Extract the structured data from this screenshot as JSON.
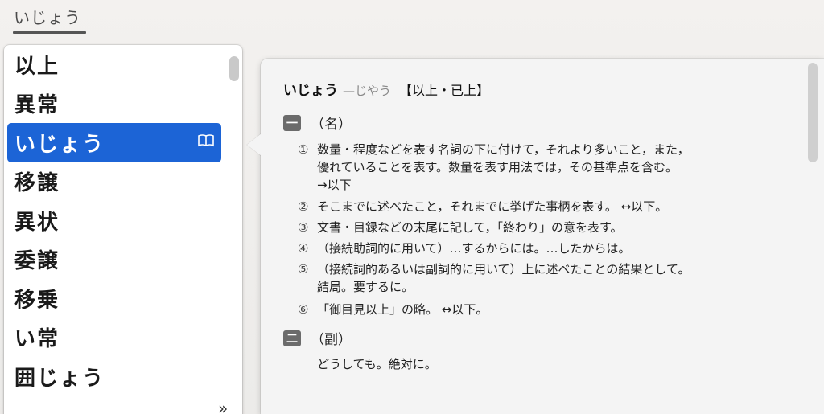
{
  "composition": {
    "text": "いじょう"
  },
  "candidates": {
    "items": [
      {
        "label": "以上"
      },
      {
        "label": "異常"
      },
      {
        "label": "いじょう",
        "selected": true
      },
      {
        "label": "移譲"
      },
      {
        "label": "異状"
      },
      {
        "label": "委譲"
      },
      {
        "label": "移乗"
      },
      {
        "label": "い常"
      },
      {
        "label": "囲じょう"
      }
    ],
    "expand_label": "»"
  },
  "dictionary": {
    "reading": "いじょう",
    "alt_reading": "—じやう",
    "kanji": "【以上・已上】",
    "sections": [
      {
        "mark": "一",
        "pos": "（名）",
        "senses": [
          {
            "num": "①",
            "lines": [
              "数量・程度などを表す名詞の下に付けて，それより多いこと，また，",
              "優れていることを表す。数量を表す用法では，その基準点を含む。",
              "→以下"
            ]
          },
          {
            "num": "②",
            "lines": [
              "そこまでに述べたこと，それまでに挙げた事柄を表す。 ↔以下。"
            ]
          },
          {
            "num": "③",
            "lines": [
              "文書・目録などの末尾に記して，「終わり」の意を表す。"
            ]
          },
          {
            "num": "④",
            "lines": [
              "（接続助詞的に用いて）…するからには。…したからは。"
            ]
          },
          {
            "num": "⑤",
            "lines": [
              "（接続詞的あるいは副詞的に用いて）上に述べたことの結果として。",
              "結局。要するに。"
            ]
          },
          {
            "num": "⑥",
            "lines": [
              "「御目見以上」の略。 ↔以下。"
            ]
          }
        ]
      },
      {
        "mark": "二",
        "pos": "（副）",
        "text": "どうしても。絶対に。"
      }
    ]
  }
}
